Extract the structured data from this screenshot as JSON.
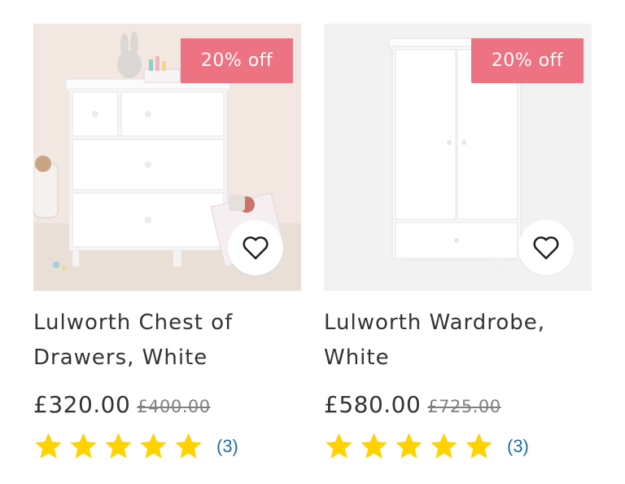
{
  "products": [
    {
      "title_line1": "Lulworth Chest of",
      "title_line2": "Drawers, White",
      "badge": "20% off",
      "price_now": "£320.00",
      "price_was": "£400.00",
      "rating_stars": 5,
      "review_count": "(3)"
    },
    {
      "title_line1": "Lulworth Wardrobe,",
      "title_line2": "White",
      "badge": "20% off",
      "price_now": "£580.00",
      "price_was": "£725.00",
      "rating_stars": 5,
      "review_count": "(3)"
    }
  ],
  "colors": {
    "badge": "#ed7382",
    "star": "#ffd200",
    "review_link": "#1f6ea1",
    "text": "#333333",
    "was_price": "#808080"
  }
}
